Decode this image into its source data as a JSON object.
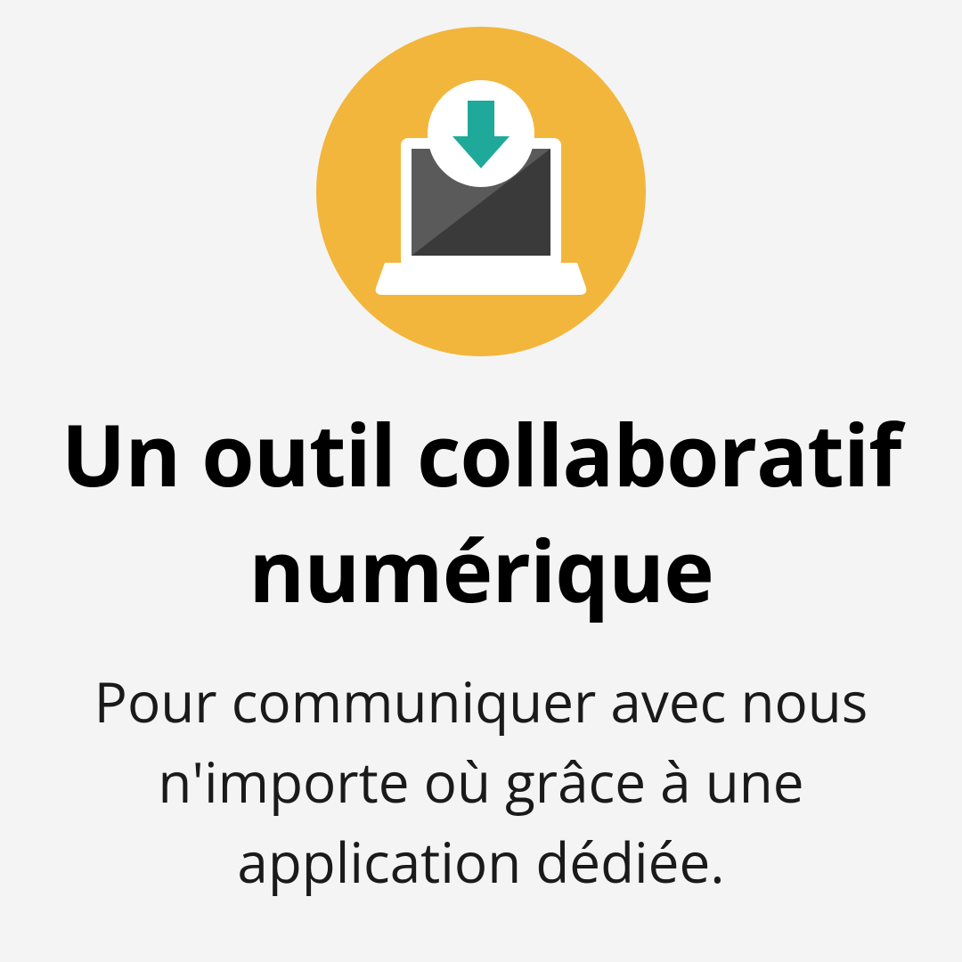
{
  "icon": {
    "name": "laptop-download-icon",
    "colors": {
      "circle": "#f2b63c",
      "laptop_body": "#ffffff",
      "laptop_screen_dark": "#3a3a3a",
      "laptop_screen_light": "#5a5a5a",
      "download_circle": "#ffffff",
      "arrow": "#1fa99a"
    }
  },
  "heading": "Un outil collaboratif numérique",
  "description": "Pour communiquer avec nous n'importe où grâce à une application dédiée."
}
